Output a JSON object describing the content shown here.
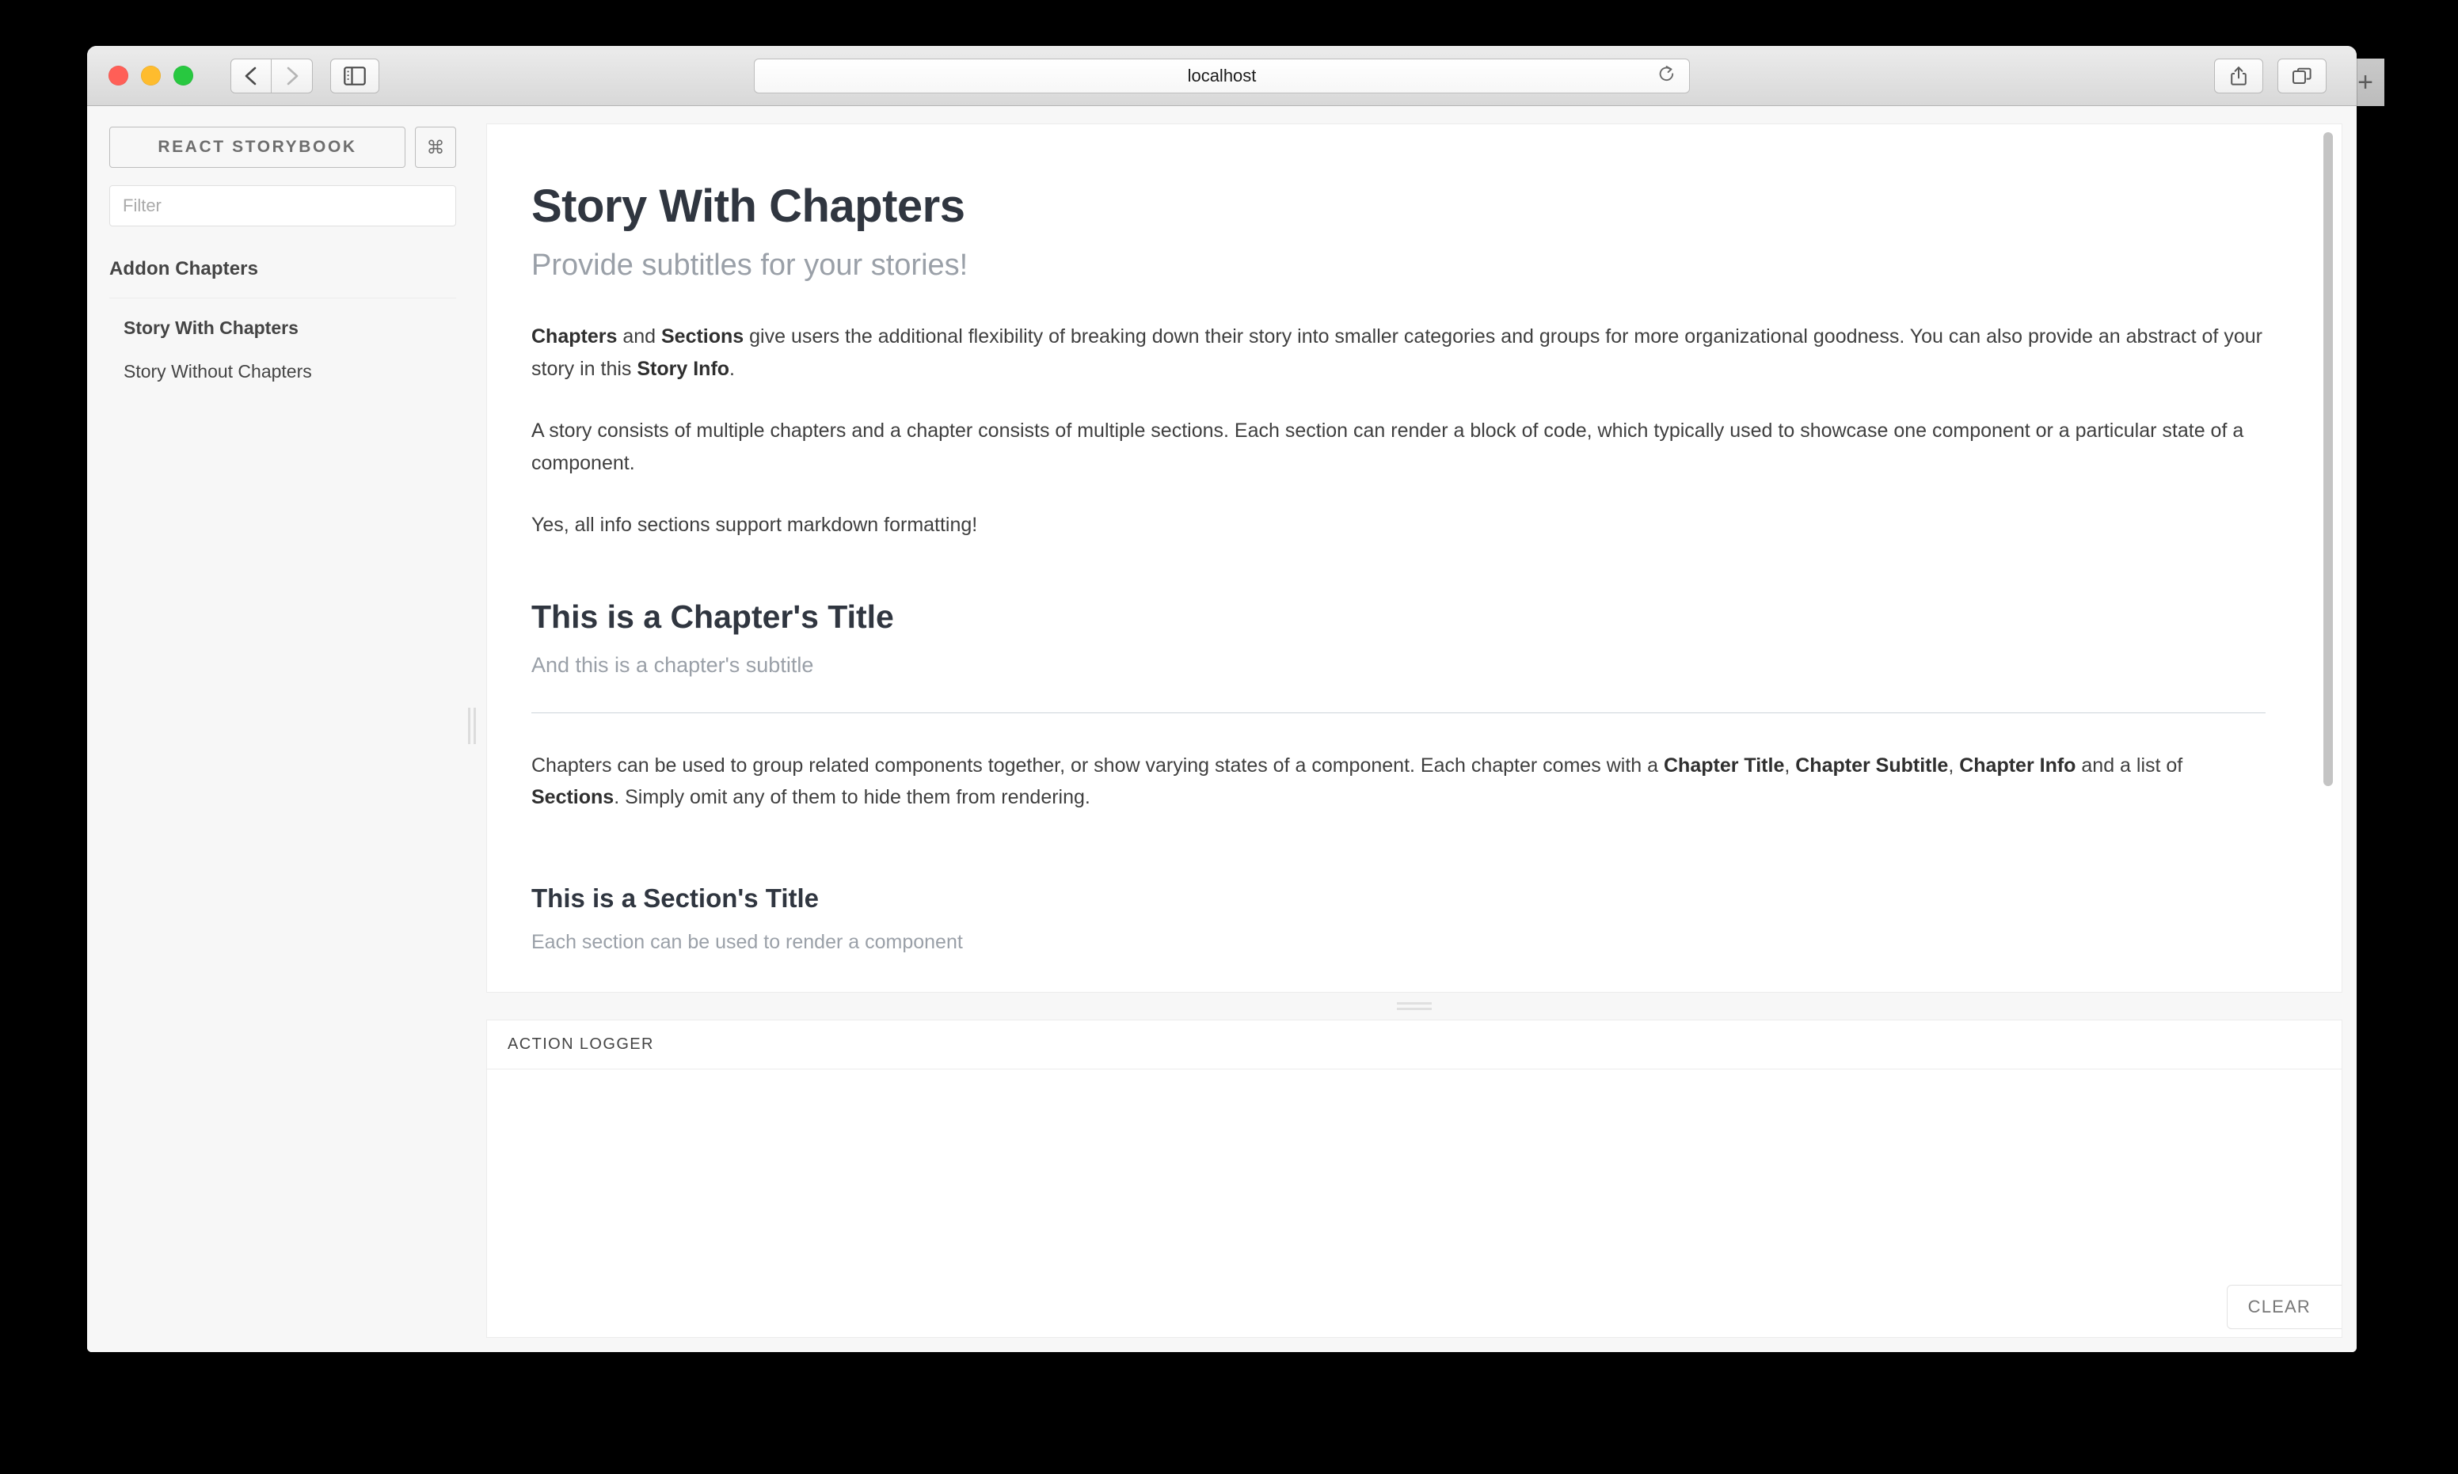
{
  "browser": {
    "url": "localhost",
    "traffic_lights": [
      "close",
      "minimize",
      "zoom"
    ],
    "back_icon": "chevron-left-icon",
    "forward_icon": "chevron-right-icon",
    "sidebar_icon": "sidebar-toggle-icon",
    "reload_icon": "reload-icon",
    "share_icon": "share-icon",
    "tabs_icon": "show-tabs-icon",
    "new_tab_label": "+"
  },
  "sidebar": {
    "brand": "REACT STORYBOOK",
    "shortcut_key": "⌘",
    "filter_placeholder": "Filter",
    "filter_value": "",
    "kind": "Addon Chapters",
    "stories": [
      {
        "label": "Story With Chapters",
        "selected": true
      },
      {
        "label": "Story Without Chapters",
        "selected": false
      }
    ]
  },
  "story": {
    "title": "Story With Chapters",
    "subtitle": "Provide subtitles for your stories!",
    "info_p1_a": "Chapters",
    "info_p1_b": " and ",
    "info_p1_c": "Sections",
    "info_p1_d": " give users the additional flexibility of breaking down their story into smaller categories and groups for more organizational goodness. You can also provide an abstract of your story in this ",
    "info_p1_e": "Story Info",
    "info_p1_f": ".",
    "info_p2": "A story consists of multiple chapters and a chapter consists of multiple sections. Each section can render a block of code, which typically used to showcase one component or a particular state of a component.",
    "info_p3": "Yes, all info sections support markdown formatting!",
    "chapter": {
      "title": "This is a Chapter's Title",
      "subtitle": "And this is a chapter's subtitle",
      "info_a": "Chapters can be used to group related components together, or show varying states of a component. Each chapter comes with a ",
      "info_b": "Chapter Title",
      "info_c": ", ",
      "info_d": "Chapter Subtitle",
      "info_e": ", ",
      "info_f": "Chapter Info",
      "info_g": " and a list of ",
      "info_h": "Sections",
      "info_i": ". Simply omit any of them to hide them from rendering."
    },
    "section": {
      "title": "This is a Section's Title",
      "subtitle": "Each section can be used to render a component",
      "button_label": "",
      "button_color": "#3db863"
    }
  },
  "addon_panel": {
    "tab": "ACTION LOGGER",
    "clear_label": "CLEAR",
    "log_entries": []
  }
}
